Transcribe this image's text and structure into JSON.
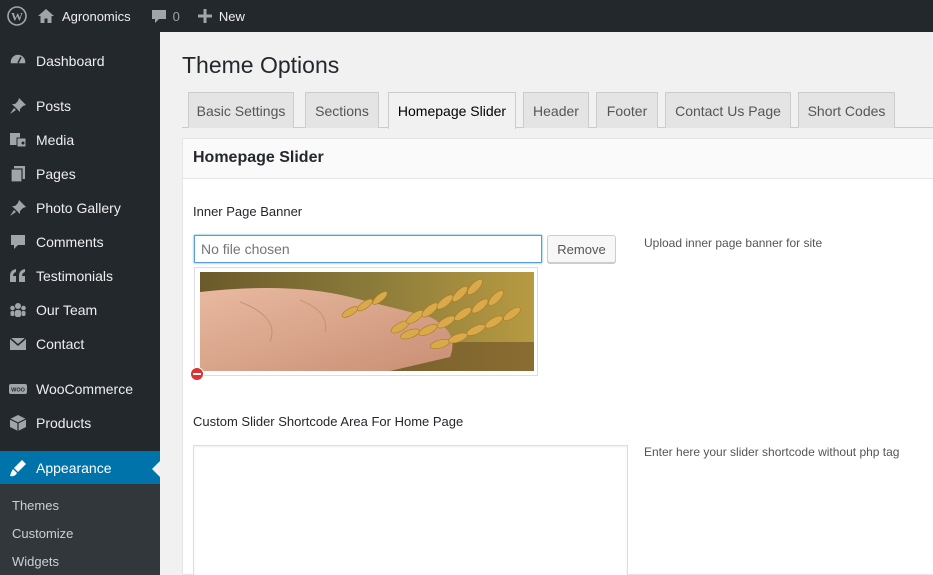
{
  "adminbar": {
    "site_name": "Agronomics",
    "comments_count": "0",
    "new_label": "New"
  },
  "sidebar": {
    "items": [
      {
        "label": "Dashboard",
        "icon": "dashboard-icon"
      },
      {
        "label": "Posts",
        "icon": "pin-icon"
      },
      {
        "label": "Media",
        "icon": "media-icon"
      },
      {
        "label": "Pages",
        "icon": "pages-icon"
      },
      {
        "label": "Photo Gallery",
        "icon": "pin-icon"
      },
      {
        "label": "Comments",
        "icon": "comment-icon"
      },
      {
        "label": "Testimonials",
        "icon": "quote-icon"
      },
      {
        "label": "Our Team",
        "icon": "groups-icon"
      },
      {
        "label": "Contact",
        "icon": "email-icon"
      },
      {
        "label": "WooCommerce",
        "icon": "woo-icon"
      },
      {
        "label": "Products",
        "icon": "box-icon"
      },
      {
        "label": "Appearance",
        "icon": "brush-icon"
      }
    ],
    "submenu": [
      "Themes",
      "Customize",
      "Widgets"
    ]
  },
  "page": {
    "title": "Theme Options",
    "tabs": [
      "Basic Settings",
      "Sections",
      "Homepage Slider",
      "Header",
      "Footer",
      "Contact Us Page",
      "Short Codes"
    ],
    "active_tab": "Homepage Slider"
  },
  "panel": {
    "heading": "Homepage Slider",
    "banner": {
      "label": "Inner Page Banner",
      "placeholder": "No file chosen",
      "remove_label": "Remove",
      "description": "Upload inner page banner for site"
    },
    "shortcode": {
      "label": "Custom Slider Shortcode Area For Home Page",
      "description": "Enter here your slider shortcode without php tag"
    }
  },
  "colors": {
    "adminbar": "#23282d",
    "accent": "#0073aa",
    "remove_icon": "#dc3232"
  }
}
